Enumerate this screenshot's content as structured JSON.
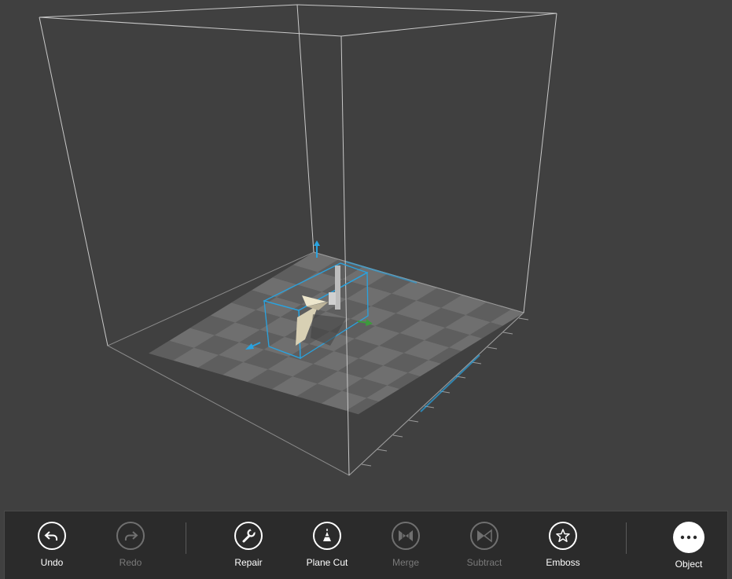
{
  "commands": {
    "undo": "Undo",
    "redo": "Redo",
    "repair": "Repair",
    "plane_cut": "Plane Cut",
    "merge": "Merge",
    "subtract": "Subtract",
    "emboss": "Emboss",
    "object": "Object"
  },
  "icons": {
    "undo": "undo-arrow-icon",
    "redo": "redo-arrow-icon",
    "repair": "wrench-icon",
    "plane_cut": "plane-cut-icon",
    "merge": "merge-icon",
    "subtract": "subtract-icon",
    "emboss": "star-icon",
    "object": "more-ellipsis-icon"
  },
  "state": {
    "redo_enabled": false,
    "merge_enabled": false,
    "subtract_enabled": false
  },
  "colors": {
    "background": "#404040",
    "app_bar": "#2b2b2b",
    "selection_accent": "#29a3e0",
    "axis_y_green": "#3c9b3c",
    "model": "#ede6cc"
  }
}
